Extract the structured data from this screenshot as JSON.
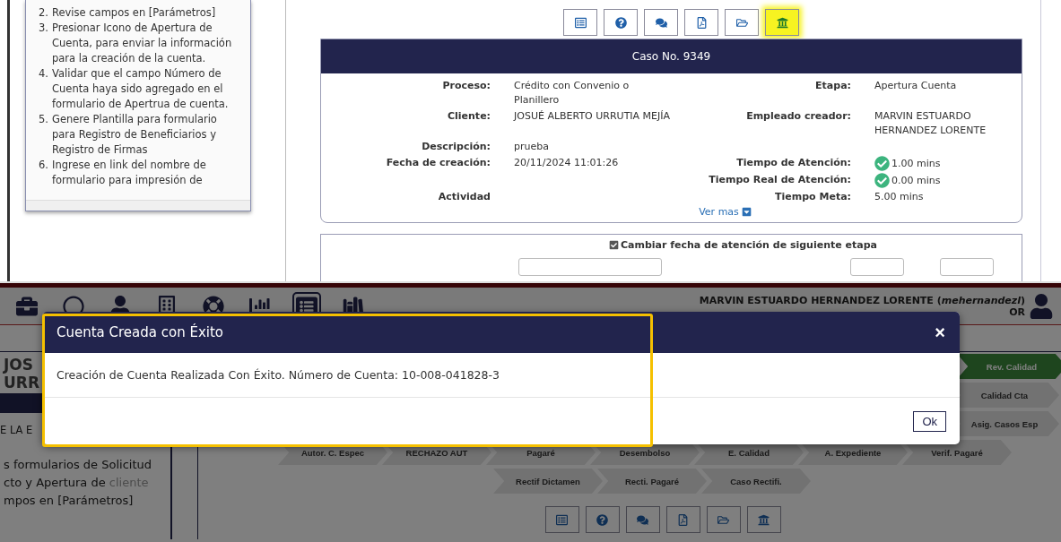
{
  "instructions_popup": {
    "items": [
      {
        "number": "2.",
        "text": "Revise campos en  [Parámetros]"
      },
      {
        "number": "3.",
        "text": "Presionar Icono de Apertura de Cuenta, para enviar la información para la creación de la cuenta."
      },
      {
        "number": "4.",
        "text": "Validar que el campo Número de Cuenta haya sido agregado en el formulario de Apertrua de cuenta."
      },
      {
        "number": "5.",
        "text": "Genere Plantilla para formulario para Registro de Beneficiarios y Registro de Firmas"
      },
      {
        "number": "6.",
        "text": "Ingrese en link del nombre de formulario para impresión de"
      }
    ]
  },
  "case_toolbar": [
    {
      "kind": "form",
      "highlighted": false
    },
    {
      "kind": "help",
      "highlighted": false
    },
    {
      "kind": "chat",
      "highlighted": false
    },
    {
      "kind": "pdf",
      "highlighted": false
    },
    {
      "kind": "folder",
      "highlighted": false
    },
    {
      "kind": "bank",
      "highlighted": true
    }
  ],
  "case_card": {
    "title": "Caso No. 9349",
    "rows": [
      {
        "left": {
          "label": "Proceso:",
          "value": "Crédito con Convenio o Planillero"
        },
        "right": {
          "label": "Etapa:",
          "value": "Apertura Cuenta",
          "kind": "plain"
        }
      },
      {
        "left": {
          "label": "Cliente:",
          "value": "JOSUÉ ALBERTO URRUTIA MEJÍA"
        },
        "right": {
          "label": "Empleado creador:",
          "value": "MARVIN ESTUARDO HERNANDEZ LORENTE",
          "kind": "plain"
        }
      },
      {
        "left": {
          "label": "Descripción:",
          "value": "prueba"
        }
      },
      {
        "left": {
          "label": "Fecha de creación:",
          "value": "20/11/2024 11:01:26"
        },
        "right": {
          "label": "Tiempo de Atención:",
          "value": "1.00 mins",
          "kind": "check"
        }
      },
      {
        "right": {
          "label": "Tiempo Real de Atención:",
          "value": "0.00 mins",
          "kind": "check"
        }
      },
      {
        "left": {
          "label": "Actividad"
        },
        "right": {
          "label": "Tiempo Meta:",
          "value": "5.00 mins",
          "kind": "plain"
        }
      }
    ],
    "more_link": "Ver mas"
  },
  "next_stage": {
    "checked": true,
    "label": "Cambiar fecha de atención de siguiente etapa"
  },
  "app_header": {
    "nav_icons": [
      {
        "kind": "briefcase",
        "selected": false
      },
      {
        "kind": "circle",
        "selected": false
      },
      {
        "kind": "person",
        "selected": false
      },
      {
        "kind": "building",
        "selected": false
      },
      {
        "kind": "lifebuoy",
        "selected": false
      },
      {
        "kind": "chart",
        "selected": false
      },
      {
        "kind": "list",
        "selected": true
      },
      {
        "kind": "books",
        "selected": false
      }
    ],
    "user_name": "MARVIN ESTUARDO HERNANDEZ LORENTE  (*mehernandezl*)",
    "role": "OR"
  },
  "sidebar": {
    "name_lines": [
      "JOS",
      "URR"
    ],
    "section_title": "E LA E",
    "lines": [
      {
        "text": "s formularios de Solicitud"
      },
      {
        "text": "cto y Apertura de",
        "faint": "cliente"
      },
      {
        "text": "mpos en  [Parámetros]"
      }
    ]
  },
  "process_steps": [
    [
      {
        "label": "Rev. Calidad",
        "active": true
      }
    ],
    [
      {
        "label": "Calidad Cta",
        "active": false
      }
    ],
    [
      {
        "label": "Asig. Casos Esp",
        "active": false
      }
    ],
    [
      {
        "label": "Autor. C. Espec",
        "active": false
      },
      {
        "label": "RECHAZO AUT",
        "active": false
      },
      {
        "label": "Pagaré",
        "active": false
      },
      {
        "label": "Desembolso",
        "active": false
      },
      {
        "label": "E. Calidad",
        "active": false
      },
      {
        "label": "A. Expediente",
        "active": false
      },
      {
        "label": "Verif. Pagaré",
        "active": false
      }
    ],
    [
      {
        "label": "Rectif Dictamen",
        "active": false
      },
      {
        "label": "Recti. Pagaré",
        "active": false
      },
      {
        "label": "Caso Rectifi.",
        "active": false
      }
    ]
  ],
  "bottom_toolbar": [
    {
      "kind": "form",
      "highlighted": false
    },
    {
      "kind": "help",
      "highlighted": false
    },
    {
      "kind": "chat",
      "highlighted": false
    },
    {
      "kind": "pdf",
      "highlighted": false
    },
    {
      "kind": "folder",
      "highlighted": false
    },
    {
      "kind": "bank",
      "highlighted": false
    }
  ],
  "dialog": {
    "title": "Cuenta Creada con Éxito",
    "close": "×",
    "message": "Creación de Cuenta Realizada Con Éxito. Número de Cuenta: 10-008-041828-3",
    "ok": "Ok"
  }
}
